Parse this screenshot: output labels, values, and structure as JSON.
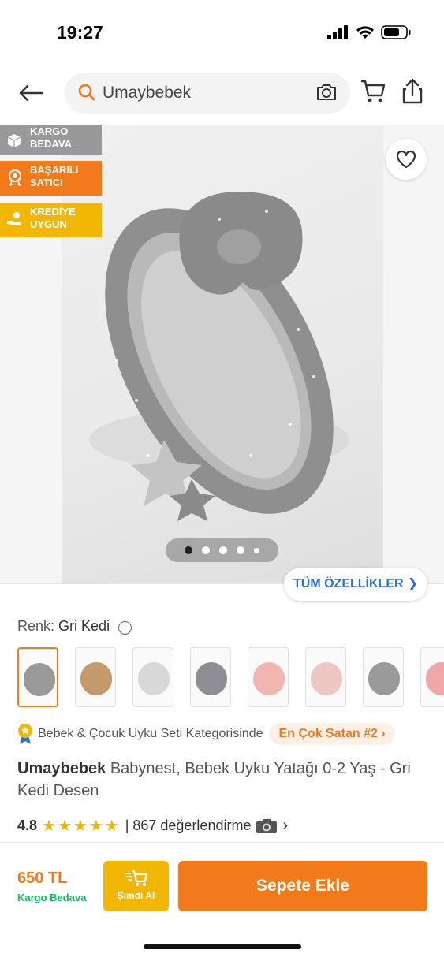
{
  "status_bar": {
    "time": "19:27"
  },
  "search": {
    "query": "Umaybebek"
  },
  "badges": [
    {
      "label": "KARGO BEDAVA",
      "color": "#999999"
    },
    {
      "label": "BAŞARILI SATICI",
      "color": "#F27A1A"
    },
    {
      "label": "KREDİYE UYGUN",
      "color": "#F2B705"
    }
  ],
  "gallery": {
    "image_count": 5,
    "active_index": 0,
    "all_features_label": "TÜM ÖZELLİKLER"
  },
  "color": {
    "label": "Renk:",
    "value": "Gri Kedi"
  },
  "swatches": [
    {
      "bed": "#9a9a9a",
      "selected": true
    },
    {
      "bed": "#c49a6c",
      "selected": false
    },
    {
      "bed": "#d8d8d8",
      "selected": false
    },
    {
      "bed": "#8e8e94",
      "selected": false
    },
    {
      "bed": "#f2b6b0",
      "selected": false
    },
    {
      "bed": "#eec7c2",
      "selected": false
    },
    {
      "bed": "#9a9a9a",
      "selected": false
    },
    {
      "bed": "#f0a7a7",
      "selected": false
    }
  ],
  "category": {
    "text": "Bebek & Çocuk Uyku Seti Kategorisinde",
    "best_seller": "En Çok Satan #2"
  },
  "product": {
    "brand": "Umaybebek",
    "name": "Babynest, Bebek Uyku Yatağı 0-2 Yaş - Gri Kedi Desen"
  },
  "rating": {
    "score": "4.8",
    "stars": "★★★★★",
    "reviews": "| 867 değerlendirme"
  },
  "purchase": {
    "price": "650 TL",
    "shipping": "Kargo Bedava",
    "buy_now": "Şimdi Al",
    "add_to_cart": "Sepete Ekle"
  },
  "colors": {
    "accent": "#F27A1A",
    "yellow": "#F2B705",
    "link": "#2E6FD1",
    "green": "#0BC15C"
  }
}
